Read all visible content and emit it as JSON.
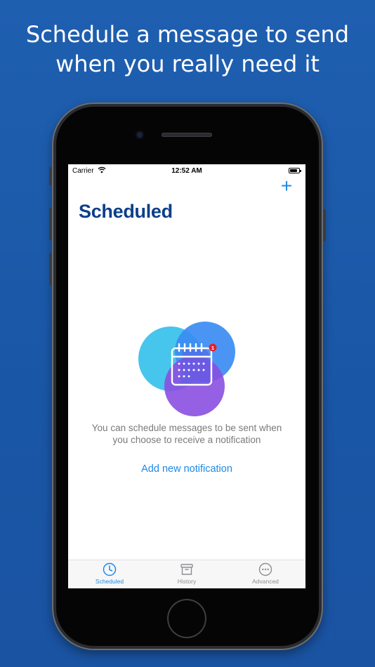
{
  "headline": {
    "line1": "Schedule a message to send",
    "line2": "when you really need it"
  },
  "status_bar": {
    "carrier": "Carrier",
    "time": "12:52 AM"
  },
  "header": {
    "add_label": "+",
    "title": "Scheduled"
  },
  "empty_state": {
    "badge_count": "1",
    "message": "You can schedule messages to be sent when you choose to receive a notification",
    "action_label": "Add new notification"
  },
  "tabs": [
    {
      "label": "Scheduled",
      "icon": "clock-icon",
      "active": true
    },
    {
      "label": "History",
      "icon": "archive-box-icon",
      "active": false
    },
    {
      "label": "Advanced",
      "icon": "more-circle-icon",
      "active": false
    }
  ],
  "colors": {
    "background": "#1a56a6",
    "title": "#0b3f8a",
    "accent": "#1e88e5",
    "badge": "#e5202e"
  }
}
